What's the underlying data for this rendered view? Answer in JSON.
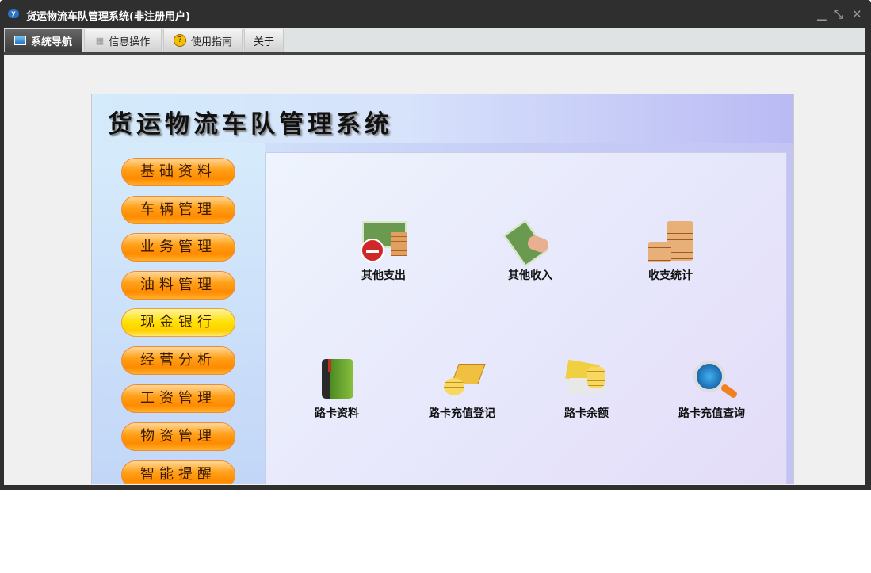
{
  "window": {
    "title": "货运物流车队管理系统(非注册用户)",
    "app_icon_text": "y"
  },
  "tabs": [
    {
      "label": "系统导航"
    },
    {
      "label": "信息操作"
    },
    {
      "label": "使用指南"
    },
    {
      "label": "关于"
    }
  ],
  "header": {
    "title": "货运物流车队管理系统"
  },
  "sidebar": {
    "items": [
      {
        "label": "基础资料"
      },
      {
        "label": "车辆管理"
      },
      {
        "label": "业务管理"
      },
      {
        "label": "油料管理"
      },
      {
        "label": "现金银行"
      },
      {
        "label": "经营分析"
      },
      {
        "label": "工资管理"
      },
      {
        "label": "物资管理"
      },
      {
        "label": "智能提醒"
      }
    ]
  },
  "main": {
    "items": [
      {
        "label": "其他支出"
      },
      {
        "label": "其他收入"
      },
      {
        "label": "收支统计"
      },
      {
        "label": "路卡资料"
      },
      {
        "label": "路卡充值登记"
      },
      {
        "label": "路卡余额"
      },
      {
        "label": "路卡充值查询"
      }
    ]
  }
}
